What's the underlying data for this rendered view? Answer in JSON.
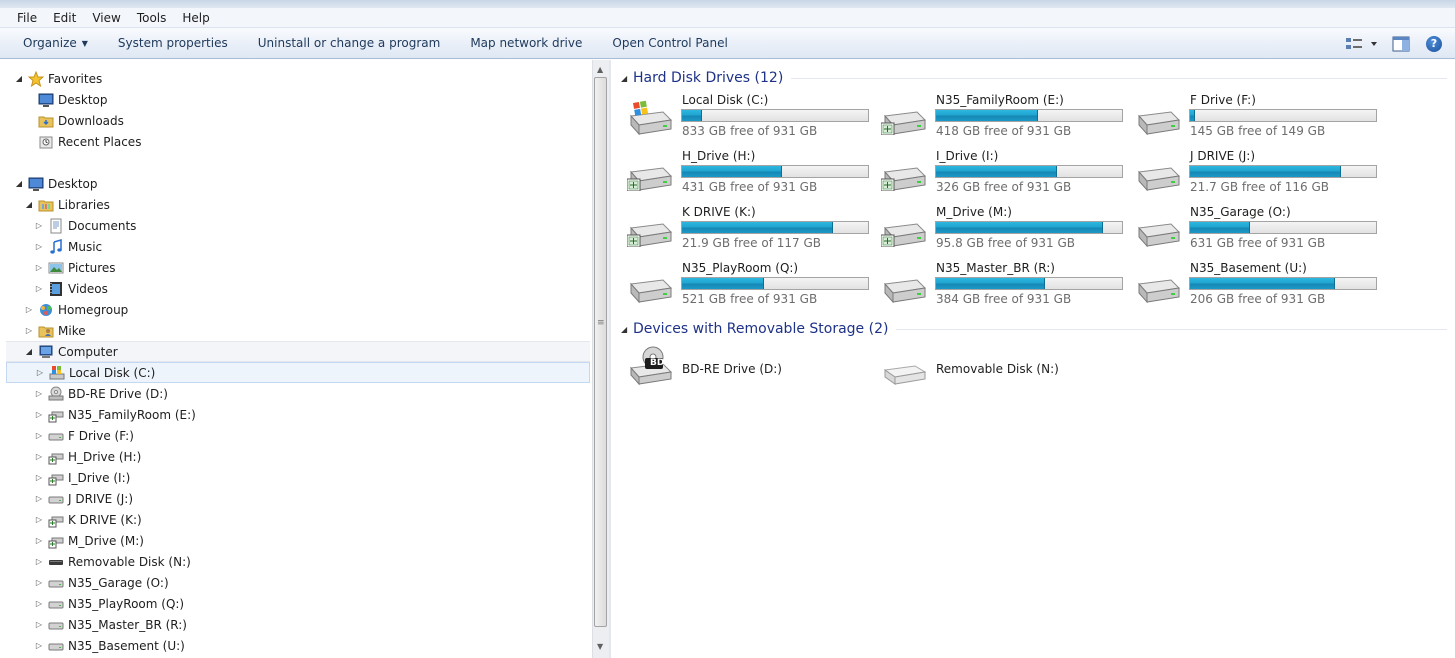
{
  "menu": [
    "File",
    "Edit",
    "View",
    "Tools",
    "Help"
  ],
  "toolbar": {
    "organize": "Organize",
    "buttons": [
      "System properties",
      "Uninstall or change a program",
      "Map network drive",
      "Open Control Panel"
    ]
  },
  "nav": {
    "items": [
      {
        "label": "Favorites",
        "icon": "star-icon",
        "level": 0,
        "arrow": "expanded"
      },
      {
        "label": "Desktop",
        "icon": "desktop-icon",
        "level": 1,
        "arrow": "none"
      },
      {
        "label": "Downloads",
        "icon": "folder-icon",
        "level": 1,
        "arrow": "none"
      },
      {
        "label": "Recent Places",
        "icon": "recent-places-icon",
        "level": 1,
        "arrow": "none"
      },
      {
        "label": "Desktop",
        "icon": "desktop-icon",
        "level": 0,
        "arrow": "expanded"
      },
      {
        "label": "Libraries",
        "icon": "libraries-icon",
        "level": 1,
        "arrow": "expanded"
      },
      {
        "label": "Documents",
        "icon": "documents-icon",
        "level": 2,
        "arrow": "collapsed"
      },
      {
        "label": "Music",
        "icon": "music-icon",
        "level": 2,
        "arrow": "collapsed"
      },
      {
        "label": "Pictures",
        "icon": "pictures-icon",
        "level": 2,
        "arrow": "collapsed"
      },
      {
        "label": "Videos",
        "icon": "videos-icon",
        "level": 2,
        "arrow": "collapsed"
      },
      {
        "label": "Homegroup",
        "icon": "homegroup-icon",
        "level": 1,
        "arrow": "collapsed"
      },
      {
        "label": "Mike",
        "icon": "user-folder-icon",
        "level": 1,
        "arrow": "collapsed"
      },
      {
        "label": "Computer",
        "icon": "computer-icon",
        "level": 1,
        "arrow": "expanded",
        "state": "hover"
      },
      {
        "label": "Local Disk (C:)",
        "icon": "windows-drive-icon",
        "level": 2,
        "arrow": "collapsed",
        "state": "selected"
      },
      {
        "label": "BD-RE Drive (D:)",
        "icon": "bd-drive-icon",
        "level": 2,
        "arrow": "collapsed"
      },
      {
        "label": "N35_FamilyRoom (E:)",
        "icon": "network-drive-icon",
        "level": 2,
        "arrow": "collapsed"
      },
      {
        "label": "F Drive (F:)",
        "icon": "hard-drive-icon",
        "level": 2,
        "arrow": "collapsed"
      },
      {
        "label": "H_Drive (H:)",
        "icon": "network-drive-icon",
        "level": 2,
        "arrow": "collapsed"
      },
      {
        "label": "I_Drive (I:)",
        "icon": "network-drive-icon",
        "level": 2,
        "arrow": "collapsed"
      },
      {
        "label": "J DRIVE (J:)",
        "icon": "hard-drive-icon",
        "level": 2,
        "arrow": "collapsed"
      },
      {
        "label": "K DRIVE (K:)",
        "icon": "network-drive-icon",
        "level": 2,
        "arrow": "collapsed"
      },
      {
        "label": "M_Drive (M:)",
        "icon": "network-drive-icon",
        "level": 2,
        "arrow": "collapsed"
      },
      {
        "label": "Removable Disk (N:)",
        "icon": "removable-disk-icon",
        "level": 2,
        "arrow": "collapsed"
      },
      {
        "label": "N35_Garage (O:)",
        "icon": "hard-drive-icon",
        "level": 2,
        "arrow": "collapsed"
      },
      {
        "label": "N35_PlayRoom (Q:)",
        "icon": "hard-drive-icon",
        "level": 2,
        "arrow": "collapsed"
      },
      {
        "label": "N35_Master_BR (R:)",
        "icon": "hard-drive-icon",
        "level": 2,
        "arrow": "collapsed"
      },
      {
        "label": "N35_Basement (U:)",
        "icon": "hard-drive-icon",
        "level": 2,
        "arrow": "collapsed"
      }
    ]
  },
  "groups": {
    "hard_disks": {
      "title": "Hard Disk Drives (12)",
      "drives": [
        {
          "name": "Local Disk (C:)",
          "free": "833 GB free of 931 GB",
          "used_fraction": 0.105,
          "icon": "windows-drive-icon"
        },
        {
          "name": "N35_FamilyRoom (E:)",
          "free": "418 GB free of 931 GB",
          "used_fraction": 0.551,
          "icon": "network-drive-icon"
        },
        {
          "name": "F Drive (F:)",
          "free": "145 GB free of 149 GB",
          "used_fraction": 0.027,
          "icon": "hard-drive-icon"
        },
        {
          "name": "H_Drive (H:)",
          "free": "431 GB free of 931 GB",
          "used_fraction": 0.537,
          "icon": "network-drive-icon"
        },
        {
          "name": "I_Drive (I:)",
          "free": "326 GB free of 931 GB",
          "used_fraction": 0.65,
          "icon": "network-drive-icon"
        },
        {
          "name": "J DRIVE (J:)",
          "free": "21.7 GB free of 116 GB",
          "used_fraction": 0.813,
          "icon": "hard-drive-icon"
        },
        {
          "name": "K DRIVE (K:)",
          "free": "21.9 GB free of 117 GB",
          "used_fraction": 0.813,
          "icon": "network-drive-icon"
        },
        {
          "name": "M_Drive (M:)",
          "free": "95.8 GB free of 931 GB",
          "used_fraction": 0.897,
          "icon": "network-drive-icon"
        },
        {
          "name": "N35_Garage (O:)",
          "free": "631 GB free of 931 GB",
          "used_fraction": 0.322,
          "icon": "hard-drive-icon"
        },
        {
          "name": "N35_PlayRoom (Q:)",
          "free": "521 GB free of 931 GB",
          "used_fraction": 0.44,
          "icon": "hard-drive-icon"
        },
        {
          "name": "N35_Master_BR (R:)",
          "free": "384 GB free of 931 GB",
          "used_fraction": 0.588,
          "icon": "hard-drive-icon"
        },
        {
          "name": "N35_Basement (U:)",
          "free": "206 GB free of 931 GB",
          "used_fraction": 0.779,
          "icon": "hard-drive-icon"
        }
      ]
    },
    "removable": {
      "title": "Devices with Removable Storage (2)",
      "devices": [
        {
          "name": "BD-RE Drive (D:)",
          "icon": "bd-drive-icon",
          "badge": "BD"
        },
        {
          "name": "Removable Disk (N:)",
          "icon": "removable-disk-icon"
        }
      ]
    }
  },
  "colors": {
    "group_title": "#1e3287",
    "bar_fill": "#1fa2cf",
    "nav_selected": "#eef4fb"
  }
}
